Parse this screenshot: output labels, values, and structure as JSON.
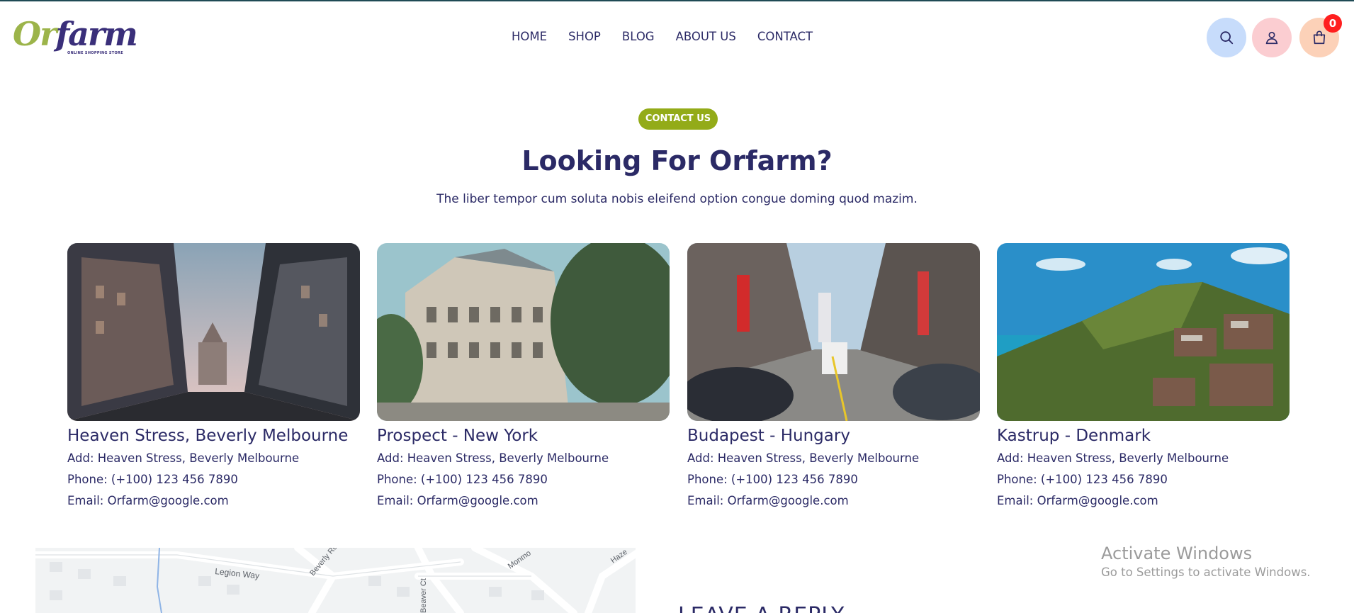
{
  "header": {
    "logo": {
      "wordmark_part1": "Or",
      "wordmark_part2": "farm",
      "tagline": "ONLINE SHOPPING STORE"
    },
    "nav": [
      {
        "label": "HOME"
      },
      {
        "label": "SHOP"
      },
      {
        "label": "BLOG"
      },
      {
        "label": "ABOUT US"
      },
      {
        "label": "CONTACT"
      }
    ],
    "icons": {
      "search": "search-icon",
      "user": "user-icon",
      "cart": "shopping-bag-icon"
    },
    "cart_count": "0"
  },
  "section": {
    "pill": "CONTACT US",
    "title": "Looking For Orfarm?",
    "subtitle": "The liber tempor cum soluta nobis eleifend option congue doming quod mazim."
  },
  "locations": [
    {
      "name": "Heaven Stress, Beverly Melbourne",
      "address": "Add: Heaven Stress, Beverly Melbourne",
      "phone": "Phone: (+100) 123 456 7890",
      "email": "Email: Orfarm@google.com"
    },
    {
      "name": "Prospect - New York",
      "address": "Add: Heaven Stress, Beverly Melbourne",
      "phone": "Phone: (+100) 123 456 7890",
      "email": "Email: Orfarm@google.com"
    },
    {
      "name": "Budapest - Hungary",
      "address": "Add: Heaven Stress, Beverly Melbourne",
      "phone": "Phone: (+100) 123 456 7890",
      "email": "Email: Orfarm@google.com"
    },
    {
      "name": "Kastrup - Denmark",
      "address": "Add: Heaven Stress, Beverly Melbourne",
      "phone": "Phone: (+100) 123 456 7890",
      "email": "Email: Orfarm@google.com"
    }
  ],
  "map": {
    "streets": [
      "Legion Way",
      "Beverly Rd",
      "Beaver Ct",
      "Monmo",
      "Haze"
    ]
  },
  "reply": {
    "heading": "LEAVE A REPLY"
  },
  "watermark": {
    "title": "Activate Windows",
    "subtitle": "Go to Settings to activate Windows."
  },
  "colors": {
    "brand_navy": "#2b2a66",
    "brand_green": "#93ab18",
    "search_bg": "#c7dcfb",
    "user_bg": "#fbcdd1",
    "cart_bg": "#fcd1b8",
    "badge": "#ff1f1f"
  }
}
